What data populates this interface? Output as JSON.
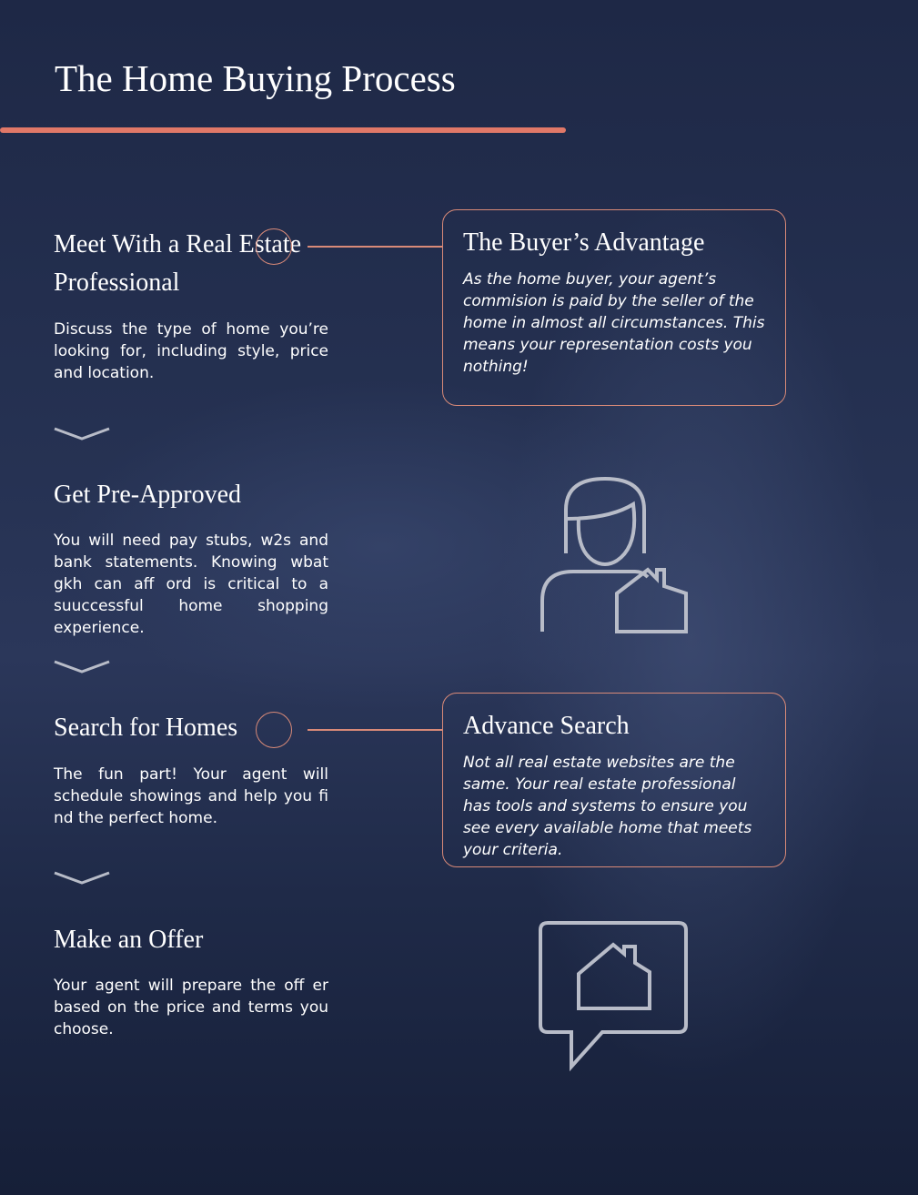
{
  "title": "The Home Buying Process",
  "steps": [
    {
      "heading": "Meet With a Real Estate Professional",
      "body": "Discuss the type of home you’re looking for, including style, price and location."
    },
    {
      "heading": "Get Pre-Approved",
      "body": "You will need pay stubs, w2s and bank statements. Knowing wbat gkh can aff ord is critical to a suuccessful home shopping experience."
    },
    {
      "heading": "Search for Homes",
      "body": "The fun part! Your agent will schedule showings and help you fi nd the perfect home."
    },
    {
      "heading": "Make an Offer",
      "body": "Your agent will prepare the off er based on the price and terms you choose."
    }
  ],
  "callouts": [
    {
      "heading": "The Buyer’s Advantage",
      "body": "As the home buyer, your agent’s commision is paid by the seller of the home in almost all circumstances. This means your representation costs you nothing!"
    },
    {
      "heading": "Advance Search",
      "body": "Not all real estate websites are the same. Your real estate professional has tools and systems to ensure you see every available home that meets your criteria."
    }
  ],
  "icons": [
    "person-house-icon",
    "speech-bubble-house-icon",
    "chevron-down-icon"
  ],
  "colors": {
    "accent": "#e07868",
    "background": "#243050"
  }
}
